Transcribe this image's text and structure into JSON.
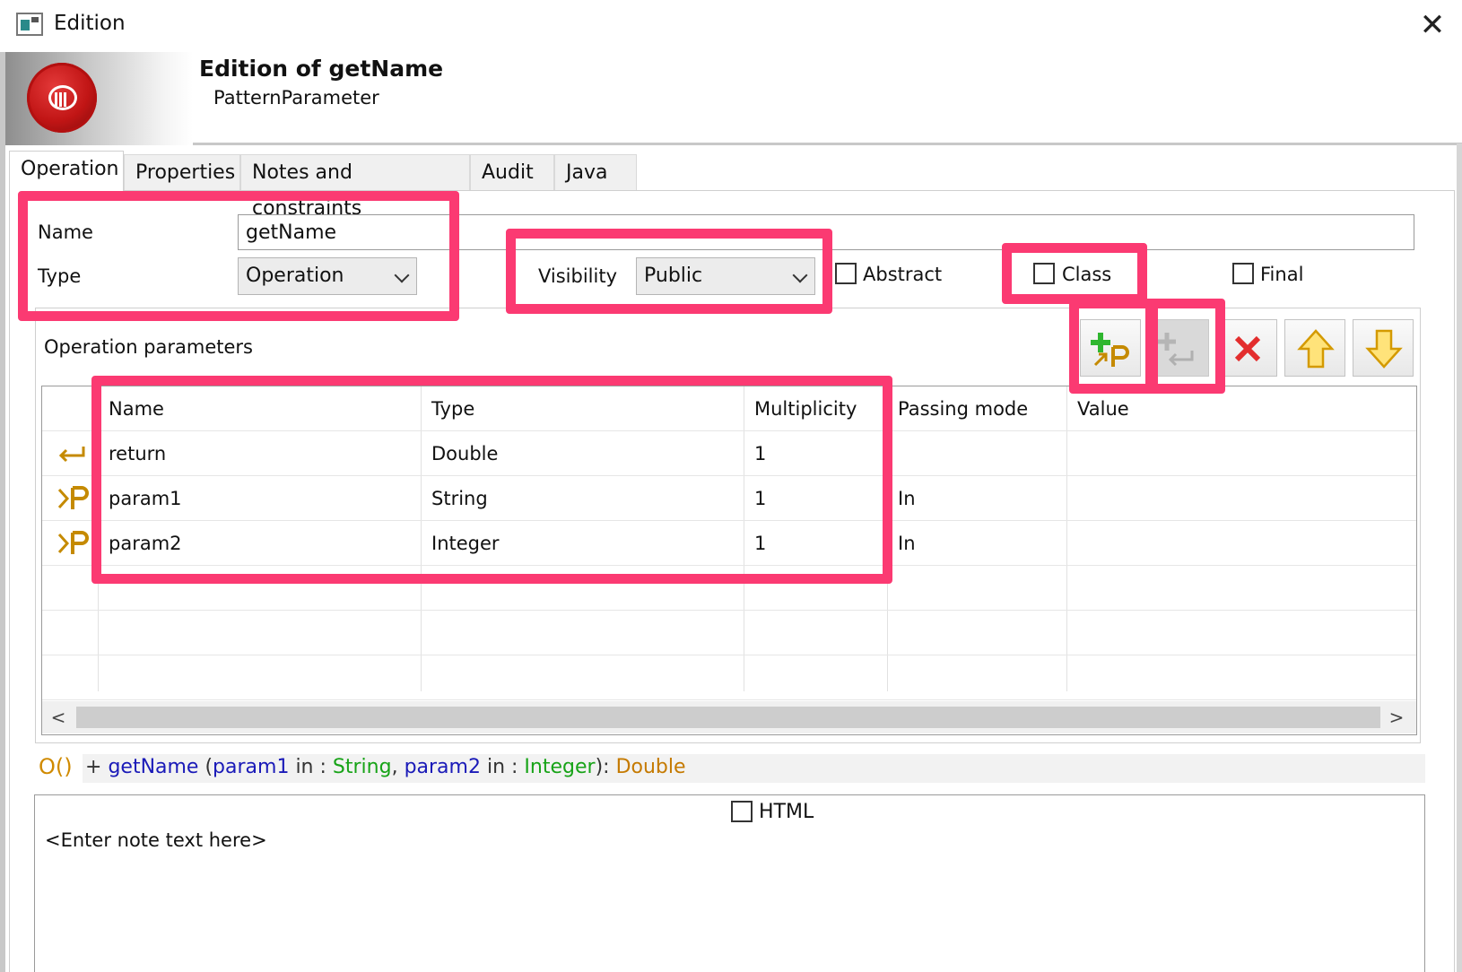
{
  "window": {
    "title": "Edition",
    "close_glyph": "✕"
  },
  "header": {
    "title": "Edition of getName",
    "subtitle": "PatternParameter"
  },
  "tabs": [
    {
      "label": "Operation",
      "active": true
    },
    {
      "label": "Properties",
      "active": false
    },
    {
      "label": "Notes and constraints",
      "active": false
    },
    {
      "label": "Audit",
      "active": false
    },
    {
      "label": "Java",
      "active": false
    }
  ],
  "form": {
    "name_label": "Name",
    "name_value": "getName",
    "type_label": "Type",
    "type_value": "Operation",
    "visibility_label": "Visibility",
    "visibility_value": "Public",
    "abstract_label": "Abstract",
    "class_label": "Class",
    "final_label": "Final"
  },
  "params": {
    "title": "Operation parameters",
    "columns": [
      "Name",
      "Type",
      "Multiplicity",
      "Passing mode",
      "Value"
    ],
    "rows": [
      {
        "icon": "return-arrow-icon",
        "name": "return",
        "type": "Double",
        "multiplicity": "1",
        "passing": "",
        "value": ""
      },
      {
        "icon": "param-in-icon",
        "name": "param1",
        "type": "String",
        "multiplicity": "1",
        "passing": "In",
        "value": ""
      },
      {
        "icon": "param-in-icon",
        "name": "param2",
        "type": "Integer",
        "multiplicity": "1",
        "passing": "In",
        "value": ""
      }
    ],
    "scroll_left": "<",
    "scroll_right": ">"
  },
  "signature": {
    "icon_text": "O()",
    "plus": "+ ",
    "name": "getName",
    "open": " (",
    "p1": "param1",
    "in1": " in : ",
    "t1": "String",
    "comma": ", ",
    "p2": "param2",
    "in2": " in : ",
    "t2": "Integer",
    "close": "): ",
    "ret": "Double"
  },
  "note": {
    "html_label": "HTML",
    "placeholder": "<Enter note text here>"
  },
  "colors": {
    "highlight": "#fb3a72",
    "type_green": "#17a317",
    "name_blue": "#1a1ab8",
    "return_orange": "#c57a00"
  }
}
